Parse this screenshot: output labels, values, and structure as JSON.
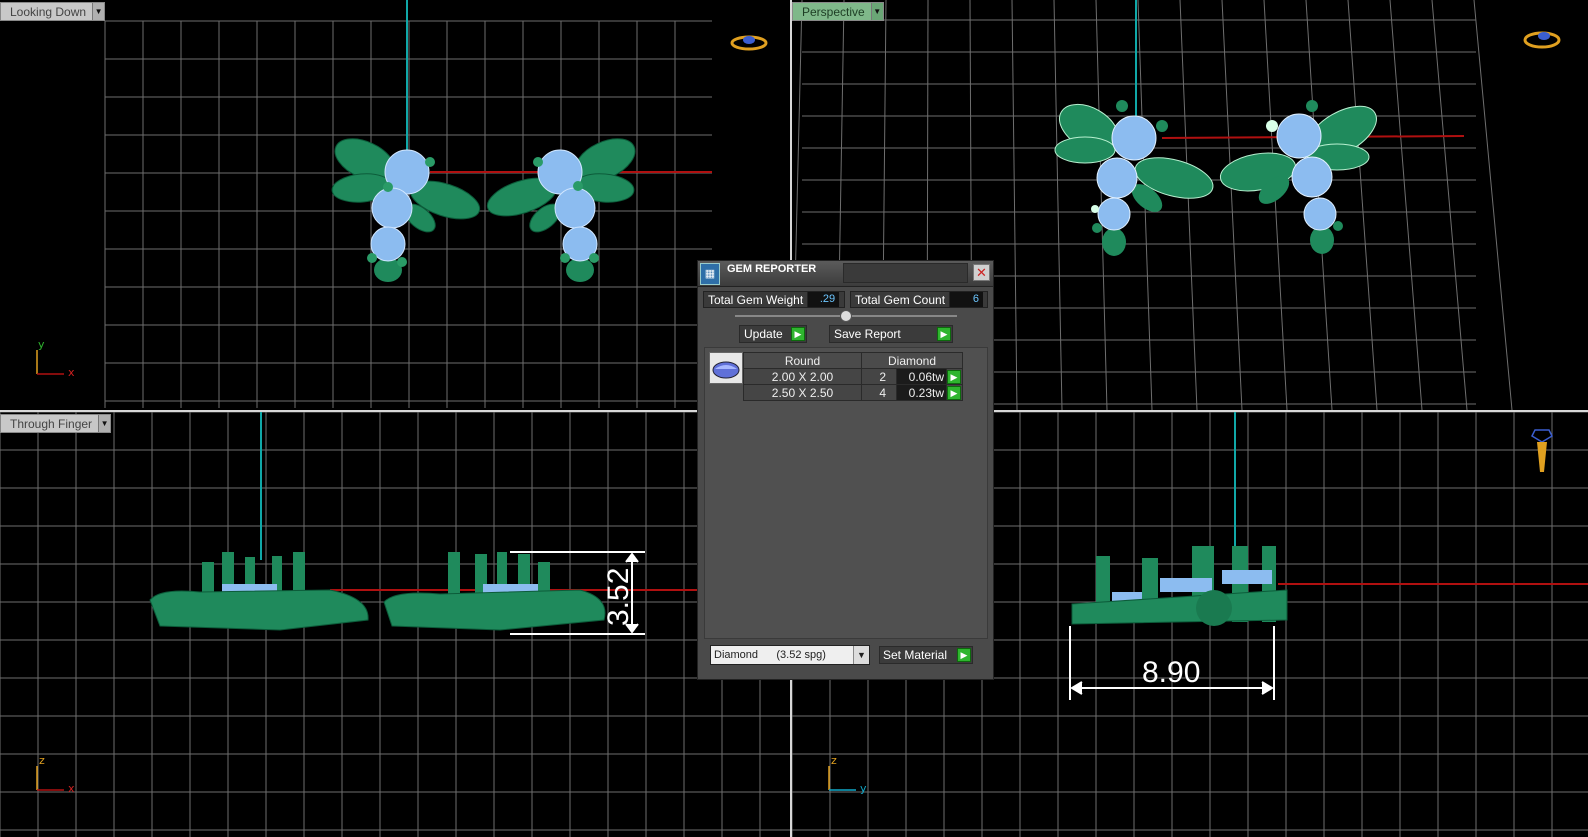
{
  "viewports": {
    "top": {
      "label": "Looking Down",
      "axis_v": "y",
      "axis_h": "x"
    },
    "perspective": {
      "label": "Perspective"
    },
    "front": {
      "label": "Through Finger",
      "axis_v": "z",
      "axis_h": "x",
      "dimension": "3.52"
    },
    "side": {
      "axis_v": "z",
      "axis_h": "y",
      "dimension": "8.90"
    }
  },
  "gem_reporter": {
    "title": "GEM REPORTER",
    "total_weight_label": "Total Gem Weight",
    "total_weight_value": ".29",
    "total_count_label": "Total Gem Count",
    "total_count_value": "6",
    "update_label": "Update",
    "save_report_label": "Save Report",
    "table": {
      "headers": [
        "Round",
        "Diamond"
      ],
      "rows": [
        {
          "size": "2.00 X 2.00",
          "count": "2",
          "weight": "0.06tw"
        },
        {
          "size": "2.50 X 2.50",
          "count": "4",
          "weight": "0.23tw"
        }
      ]
    },
    "material_value": "Diamond      (3.52 spg)",
    "set_material_label": "Set Material"
  },
  "colors": {
    "metal": "#1f8a5c",
    "gem": "#8cbcf0",
    "grid": "#6e6e6e",
    "axis_red": "#b01010",
    "axis_teal": "#10a8a8"
  }
}
